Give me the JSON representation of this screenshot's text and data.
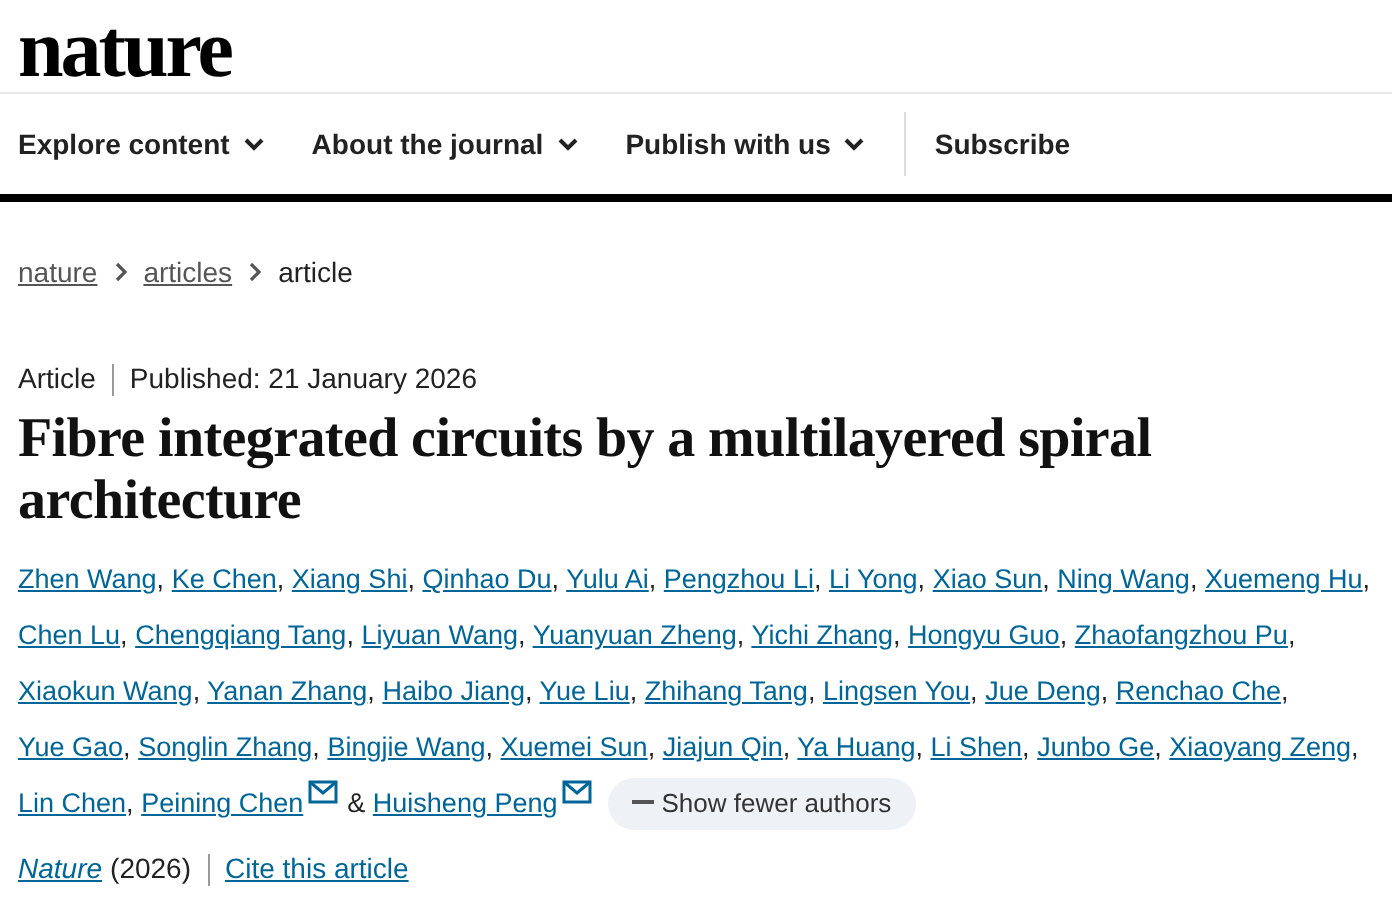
{
  "logo": "nature",
  "nav": [
    {
      "label": "Explore content",
      "dropdown": true
    },
    {
      "label": "About the journal",
      "dropdown": true
    },
    {
      "label": "Publish with us",
      "dropdown": true
    },
    {
      "label": "Subscribe",
      "dropdown": false
    }
  ],
  "breadcrumb": [
    {
      "label": "nature",
      "link": true
    },
    {
      "label": "articles",
      "link": true
    },
    {
      "label": "article",
      "link": false
    }
  ],
  "article_type": "Article",
  "published": "Published: 21 January 2026",
  "title": "Fibre integrated circuits by a multilayered spiral architecture",
  "authors": [
    {
      "name": "Zhen Wang",
      "email": false
    },
    {
      "name": "Ke Chen",
      "email": false,
      "separator": ","
    },
    {
      "name": "Xiang Shi",
      "email": false,
      "separator": ","
    },
    {
      "name": "Qinhao Du",
      "email": false,
      "separator": ","
    },
    {
      "name": "Yulu Ai",
      "email": false,
      "separator": ","
    },
    {
      "name": "Pengzhou Li",
      "email": false,
      "separator": ","
    },
    {
      "name": "Li Yong",
      "email": false,
      "separator": ","
    },
    {
      "name": "Xiao Sun",
      "email": false,
      "separator": ","
    },
    {
      "name": "Ning Wang",
      "email": false,
      "separator": ","
    },
    {
      "name": "Xuemeng Hu",
      "email": false,
      "separator": ","
    },
    {
      "name": "Chen Lu",
      "email": false,
      "separator": ","
    },
    {
      "name": "Chengqiang Tang",
      "email": false,
      "separator": ","
    },
    {
      "name": "Liyuan Wang",
      "email": false,
      "separator": ","
    },
    {
      "name": "Yuanyuan Zheng",
      "email": false,
      "separator": ","
    },
    {
      "name": "Yichi Zhang",
      "email": false,
      "separator": ","
    },
    {
      "name": "Hongyu Guo",
      "email": false,
      "separator": ","
    },
    {
      "name": "Zhaofangzhou Pu",
      "email": false,
      "separator": ","
    },
    {
      "name": "Xiaokun Wang",
      "email": false,
      "separator": ","
    },
    {
      "name": "Yanan Zhang",
      "email": false,
      "separator": ","
    },
    {
      "name": "Haibo Jiang",
      "email": false,
      "separator": ","
    },
    {
      "name": "Yue Liu",
      "email": false,
      "separator": ","
    },
    {
      "name": "Zhihang Tang",
      "email": false,
      "separator": ","
    },
    {
      "name": "Lingsen You",
      "email": false,
      "separator": ","
    },
    {
      "name": "Jue Deng",
      "email": false,
      "separator": ","
    },
    {
      "name": "Renchao Che",
      "email": false,
      "separator": ","
    },
    {
      "name": "Yue Gao",
      "email": false,
      "separator": ","
    },
    {
      "name": "Songlin Zhang",
      "email": false,
      "separator": ","
    },
    {
      "name": "Bingjie Wang",
      "email": false,
      "separator": ","
    },
    {
      "name": "Xuemei Sun",
      "email": false,
      "separator": ","
    },
    {
      "name": "Jiajun Qin",
      "email": false,
      "separator": ","
    },
    {
      "name": "Ya Huang",
      "email": false,
      "separator": ","
    },
    {
      "name": "Li Shen",
      "email": false,
      "separator": ","
    },
    {
      "name": "Junbo Ge",
      "email": false,
      "separator": ","
    },
    {
      "name": "Xiaoyang Zeng",
      "email": false,
      "separator": ","
    },
    {
      "name": "Lin Chen",
      "email": false,
      "separator": ","
    },
    {
      "name": "Peining Chen",
      "email": true,
      "separator": ","
    },
    {
      "name": "Huisheng Peng",
      "email": true,
      "separator": "&"
    }
  ],
  "show_fewer_button": "Show fewer authors",
  "citation": {
    "journal": "Nature",
    "year": "(2026)",
    "cite_link": "Cite this article"
  }
}
